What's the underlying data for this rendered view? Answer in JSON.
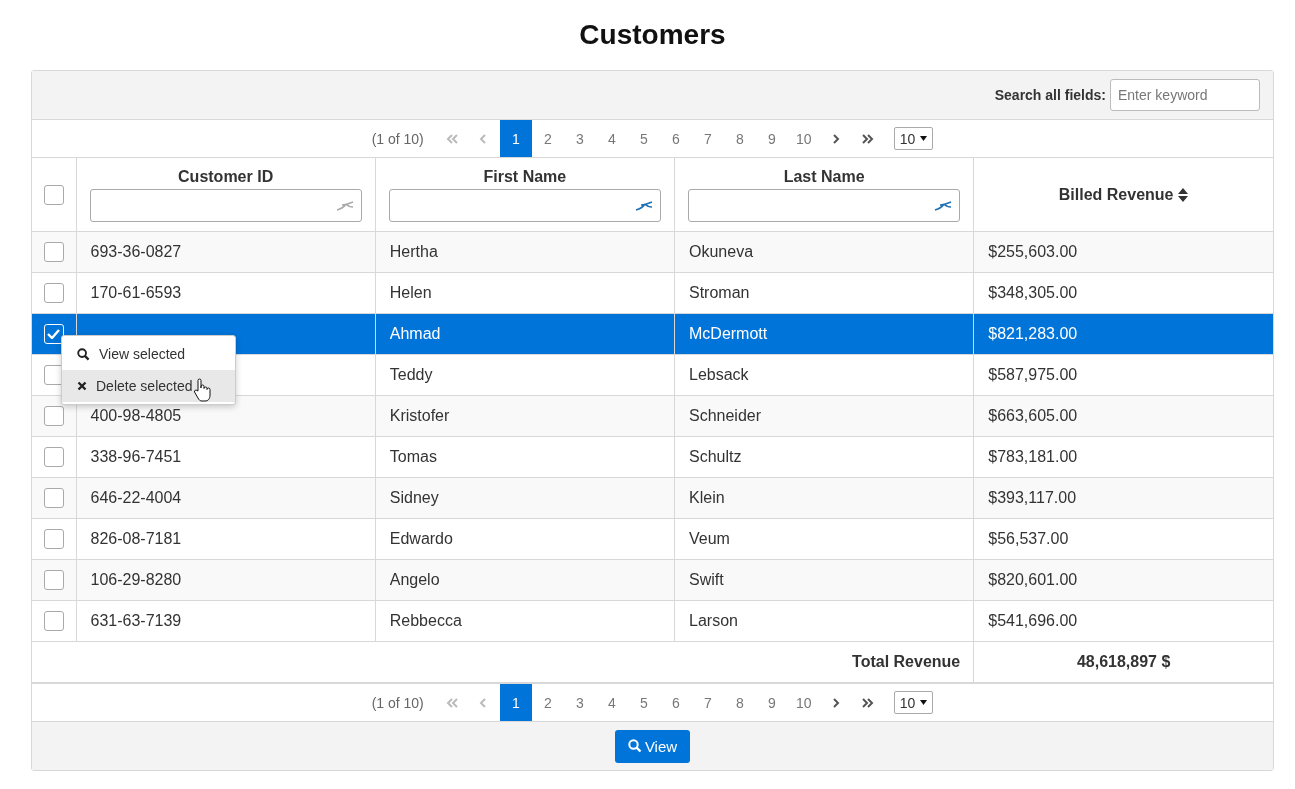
{
  "title": "Customers",
  "search": {
    "label": "Search all fields:",
    "placeholder": "Enter keyword"
  },
  "paginator_top": {
    "summary": "(1 of 10)",
    "nav": [
      {
        "kind": "first",
        "disabled": true
      },
      {
        "kind": "prev",
        "disabled": true
      }
    ],
    "pages": [
      {
        "label": "1",
        "selected": true
      },
      {
        "label": "2",
        "selected": false
      },
      {
        "label": "3",
        "selected": false
      },
      {
        "label": "4",
        "selected": false
      },
      {
        "label": "5",
        "selected": false
      },
      {
        "label": "6",
        "selected": false
      },
      {
        "label": "7",
        "selected": false
      },
      {
        "label": "8",
        "selected": false
      },
      {
        "label": "9",
        "selected": false
      },
      {
        "label": "10",
        "selected": false
      }
    ],
    "nav_end": [
      {
        "kind": "next",
        "disabled": false
      },
      {
        "kind": "last",
        "disabled": false
      }
    ],
    "rows_per_page": "10"
  },
  "table": {
    "select_all": {
      "checked": false
    },
    "columns": [
      {
        "label": "Customer ID",
        "kind": "filter",
        "filter_active": false
      },
      {
        "label": "First Name",
        "kind": "filter",
        "filter_active": true
      },
      {
        "label": "Last Name",
        "kind": "filter",
        "filter_active": true
      },
      {
        "label": "Billed Revenue",
        "kind": "sort"
      }
    ],
    "rows": [
      {
        "selected": false,
        "cells": [
          "693-36-0827",
          "Hertha",
          "Okuneva",
          "$255,603.00"
        ]
      },
      {
        "selected": false,
        "cells": [
          "170-61-6593",
          "Helen",
          "Stroman",
          "$348,305.00"
        ]
      },
      {
        "selected": true,
        "cells": [
          "",
          "Ahmad",
          "McDermott",
          "$821,283.00"
        ]
      },
      {
        "selected": false,
        "cells": [
          "",
          "Teddy",
          "Lebsack",
          "$587,975.00"
        ]
      },
      {
        "selected": false,
        "cells": [
          "400-98-4805",
          "Kristofer",
          "Schneider",
          "$663,605.00"
        ]
      },
      {
        "selected": false,
        "cells": [
          "338-96-7451",
          "Tomas",
          "Schultz",
          "$783,181.00"
        ]
      },
      {
        "selected": false,
        "cells": [
          "646-22-4004",
          "Sidney",
          "Klein",
          "$393,117.00"
        ]
      },
      {
        "selected": false,
        "cells": [
          "826-08-7181",
          "Edwardo",
          "Veum",
          "$56,537.00"
        ]
      },
      {
        "selected": false,
        "cells": [
          "106-29-8280",
          "Angelo",
          "Swift",
          "$820,601.00"
        ]
      },
      {
        "selected": false,
        "cells": [
          "631-63-7139",
          "Rebbecca",
          "Larson",
          "$541,696.00"
        ]
      }
    ],
    "footer": {
      "label": "Total Revenue",
      "value": "48,618,897 $"
    }
  },
  "paginator_bottom": {
    "summary": "(1 of 10)",
    "nav": [
      {
        "kind": "first",
        "disabled": true
      },
      {
        "kind": "prev",
        "disabled": true
      }
    ],
    "pages": [
      {
        "label": "1",
        "selected": true
      },
      {
        "label": "2",
        "selected": false
      },
      {
        "label": "3",
        "selected": false
      },
      {
        "label": "4",
        "selected": false
      },
      {
        "label": "5",
        "selected": false
      },
      {
        "label": "6",
        "selected": false
      },
      {
        "label": "7",
        "selected": false
      },
      {
        "label": "8",
        "selected": false
      },
      {
        "label": "9",
        "selected": false
      },
      {
        "label": "10",
        "selected": false
      }
    ],
    "nav_end": [
      {
        "kind": "next",
        "disabled": false
      },
      {
        "kind": "last",
        "disabled": false
      }
    ],
    "rows_per_page": "10"
  },
  "context_menu": {
    "items": [
      {
        "kind": "view",
        "label": "View selected",
        "hovered": false
      },
      {
        "kind": "delete",
        "label": "Delete selected",
        "hovered": true
      }
    ]
  },
  "view_button": {
    "label": "View"
  }
}
